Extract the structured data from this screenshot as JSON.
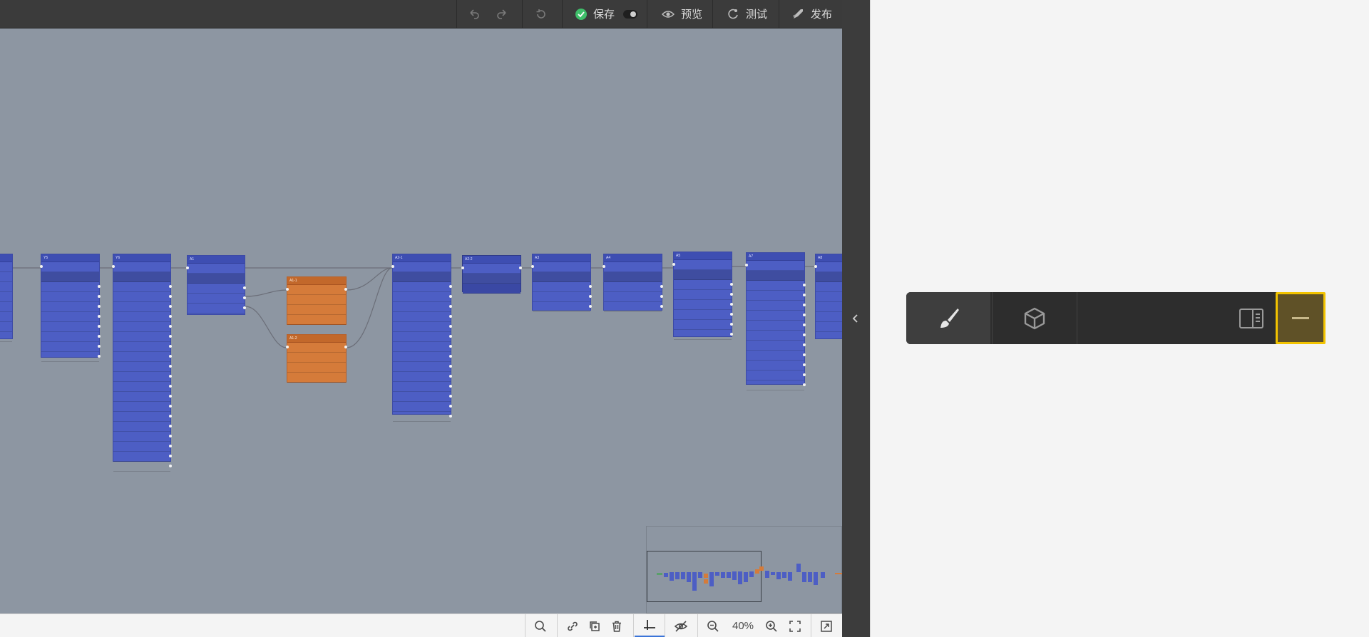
{
  "toolbar": {
    "save_label": "保存",
    "preview_label": "预览",
    "test_label": "测试",
    "publish_label": "发布"
  },
  "zoom": {
    "level": "40%"
  },
  "colors": {
    "node_blue": "#4d5ec4",
    "node_orange": "#d57b3a",
    "canvas": "#8d96a2",
    "highlight": "#f2c300"
  },
  "icons": {
    "undo": "undo-icon",
    "redo": "redo-icon",
    "reset": "history-icon",
    "save": "check-circle-icon",
    "preview": "eye-icon",
    "test": "debug-icon",
    "publish": "rocket-icon",
    "search": "search-icon",
    "link": "link-icon",
    "copy": "copy-icon",
    "delete": "trash-icon",
    "align": "align-icon",
    "hide": "eye-off-icon",
    "zoom_out": "zoom-out-icon",
    "zoom_in": "zoom-in-icon",
    "fit": "fit-view-icon",
    "expand": "expand-icon",
    "collapse": "chevron-left-icon",
    "brush": "brush-icon",
    "cube": "cube-icon",
    "panel": "side-panel-icon",
    "minus": "minus-icon"
  },
  "nodes": [
    {
      "title": "Y5",
      "type": "blue"
    },
    {
      "title": "Y6",
      "type": "blue"
    },
    {
      "title": "A1",
      "type": "blue"
    },
    {
      "title": "A1-1",
      "type": "orange"
    },
    {
      "title": "A1-2",
      "type": "orange"
    },
    {
      "title": "A2-1",
      "type": "blue"
    },
    {
      "title": "A2-2",
      "type": "blue"
    },
    {
      "title": "A3",
      "type": "blue"
    },
    {
      "title": "A4",
      "type": "blue"
    },
    {
      "title": "A5",
      "type": "blue"
    },
    {
      "title": "A7",
      "type": "blue"
    },
    {
      "title": "A8",
      "type": "blue"
    }
  ]
}
